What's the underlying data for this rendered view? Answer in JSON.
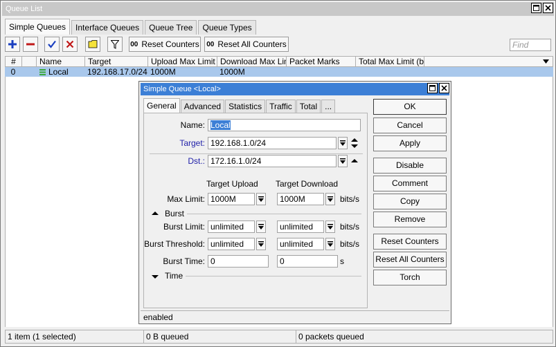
{
  "window": {
    "title": "Queue List"
  },
  "tabs": [
    {
      "label": "Simple Queues"
    },
    {
      "label": "Interface Queues"
    },
    {
      "label": "Queue Tree"
    },
    {
      "label": "Queue Types"
    }
  ],
  "toolbar": {
    "reset_counters": "Reset Counters",
    "reset_all_counters": "Reset All Counters",
    "counters_icon": "00"
  },
  "find": {
    "placeholder": "Find"
  },
  "table": {
    "headers": [
      "#",
      "",
      "Name",
      "Target",
      "Upload Max Limit",
      "Download Max Limit",
      "Packet Marks",
      "Total Max Limit (bi..."
    ],
    "rows": [
      {
        "num": "0",
        "name": "Local",
        "target": "192.168.17.0/24",
        "upload": "1000M",
        "download": "1000M",
        "marks": "",
        "total": ""
      }
    ]
  },
  "status": {
    "items": "1 item (1 selected)",
    "queued": "0 B queued",
    "packets": "0 packets queued"
  },
  "dialog": {
    "title": "Simple Queue <Local>",
    "tabs": [
      {
        "label": "General"
      },
      {
        "label": "Advanced"
      },
      {
        "label": "Statistics"
      },
      {
        "label": "Traffic"
      },
      {
        "label": "Total"
      },
      {
        "label": "..."
      }
    ],
    "name_label": "Name:",
    "name_value": "Local",
    "target_label": "Target:",
    "target_value": "192.168.1.0/24",
    "dst_label": "Dst.:",
    "dst_value": "172.16.1.0/24",
    "col_upload": "Target Upload",
    "col_download": "Target Download",
    "max_limit_label": "Max Limit:",
    "max_up": "1000M",
    "max_down": "1000M",
    "unit_bits": "bits/s",
    "burst_section": "Burst",
    "burst_limit_label": "Burst Limit:",
    "burst_limit_up": "unlimited",
    "burst_limit_down": "unlimited",
    "burst_thr_label": "Burst Threshold:",
    "burst_thr_up": "unlimited",
    "burst_thr_down": "unlimited",
    "burst_time_label": "Burst Time:",
    "burst_time_up": "0",
    "burst_time_down": "0",
    "unit_s": "s",
    "time_section": "Time",
    "status": "enabled",
    "buttons": {
      "ok": "OK",
      "cancel": "Cancel",
      "apply": "Apply",
      "disable": "Disable",
      "comment": "Comment",
      "copy": "Copy",
      "remove": "Remove",
      "reset_counters": "Reset Counters",
      "reset_all_counters": "Reset All Counters",
      "torch": "Torch"
    }
  },
  "colors": {
    "title_active": "#3c7fd6",
    "selection": "#a9c8ec",
    "add_icon": "#1a3fc0",
    "remove_icon": "#c01818"
  }
}
